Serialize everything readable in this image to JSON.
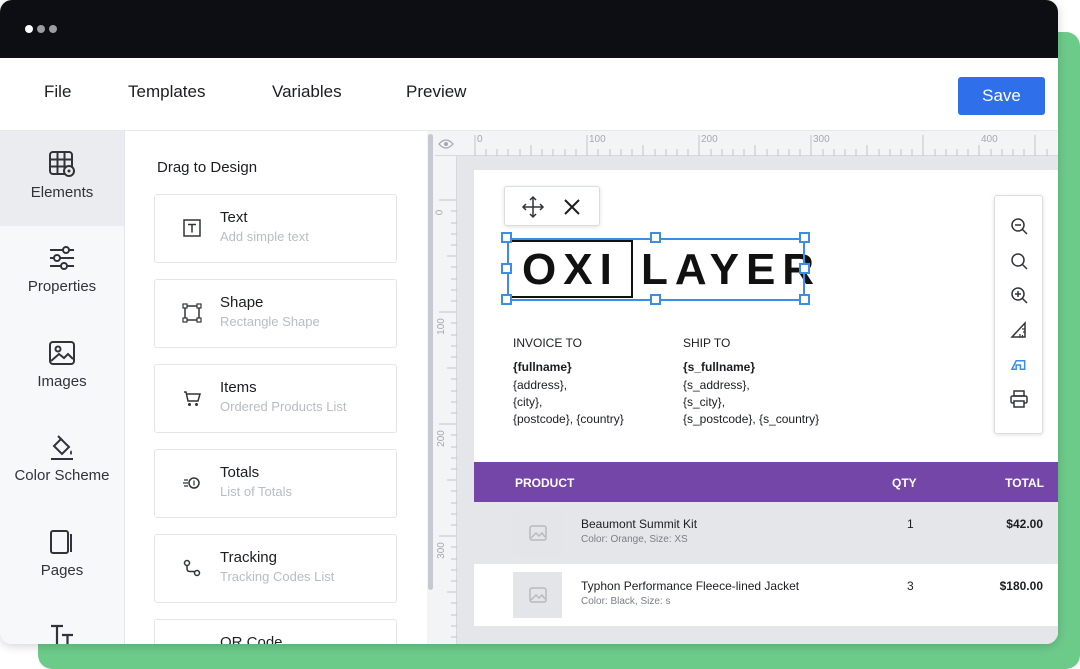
{
  "window": {
    "dots": [
      "#ffffff",
      "#9a9ca2",
      "#9a9ca2"
    ]
  },
  "menu": {
    "items": [
      "File",
      "Templates",
      "Variables",
      "Preview"
    ],
    "save_label": "Save"
  },
  "sidebar": {
    "items": [
      {
        "label": "Elements",
        "icon": "grid-settings-icon",
        "active": true
      },
      {
        "label": "Properties",
        "icon": "sliders-icon"
      },
      {
        "label": "Images",
        "icon": "image-icon"
      },
      {
        "label": "Color Scheme",
        "icon": "paint-bucket-icon"
      },
      {
        "label": "Pages",
        "icon": "pages-icon"
      },
      {
        "label": "",
        "icon": "text-size-icon"
      }
    ]
  },
  "panel": {
    "title": "Drag to Design",
    "cards": [
      {
        "title": "Text",
        "subtitle": "Add simple text",
        "icon": "text-box-icon"
      },
      {
        "title": "Shape",
        "subtitle": "Rectangle Shape",
        "icon": "shape-icon"
      },
      {
        "title": "Items",
        "subtitle": "Ordered Products List",
        "icon": "cart-icon"
      },
      {
        "title": "Totals",
        "subtitle": "List of Totals",
        "icon": "coins-icon"
      },
      {
        "title": "Tracking",
        "subtitle": "Tracking Codes List",
        "icon": "route-icon"
      },
      {
        "title": "QR Code",
        "subtitle": "",
        "icon": "qr-icon"
      }
    ]
  },
  "rulers": {
    "top": [
      "0",
      "100",
      "200",
      "300",
      "400"
    ],
    "left": [
      "0",
      "100",
      "200",
      "300"
    ]
  },
  "document": {
    "logo_left": "OXI",
    "logo_right": "LAYER",
    "invoice_to": {
      "heading": "INVOICE TO",
      "name": "{fullname}",
      "lines": [
        "{address},",
        "{city},",
        "{postcode}, {country}"
      ]
    },
    "ship_to": {
      "heading": "SHIP TO",
      "name": "{s_fullname}",
      "lines": [
        "{s_address},",
        "{s_city},",
        "{s_postcode}, {s_country}"
      ]
    },
    "table": {
      "header_color": "#7446a8",
      "columns": [
        "PRODUCT",
        "QTY",
        "TOTAL"
      ],
      "rows": [
        {
          "name": "Beaumont Summit Kit",
          "desc": "Color: Orange, Size: XS",
          "qty": "1",
          "total": "$42.00"
        },
        {
          "name": "Typhon Performance Fleece-lined Jacket",
          "desc": "Color: Black, Size: s",
          "qty": "3",
          "total": "$180.00"
        }
      ]
    }
  },
  "colors": {
    "accent": "#2f6fe9",
    "selection": "#3a8ee6",
    "backdrop": "#6dcb8a"
  }
}
